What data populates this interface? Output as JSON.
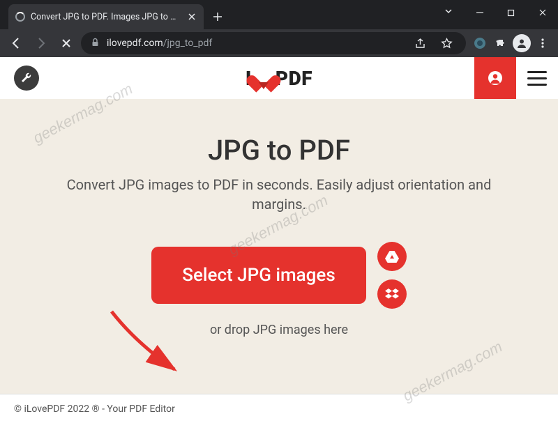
{
  "browser": {
    "tab_title": "Convert JPG to PDF. Images JPG to PDF",
    "url_domain": "ilovepdf.com",
    "url_path": "/jpg_to_pdf"
  },
  "header": {
    "logo_left": "I",
    "logo_right": "PDF"
  },
  "main": {
    "heading": "JPG to PDF",
    "subtitle": "Convert JPG images to PDF in seconds. Easily adjust orientation and margins.",
    "select_button_label": "Select JPG images",
    "drop_text": "or drop JPG images here"
  },
  "footer": {
    "text": "© iLovePDF 2022 ® - Your PDF Editor"
  },
  "watermark": {
    "text": "geekermag.com"
  }
}
